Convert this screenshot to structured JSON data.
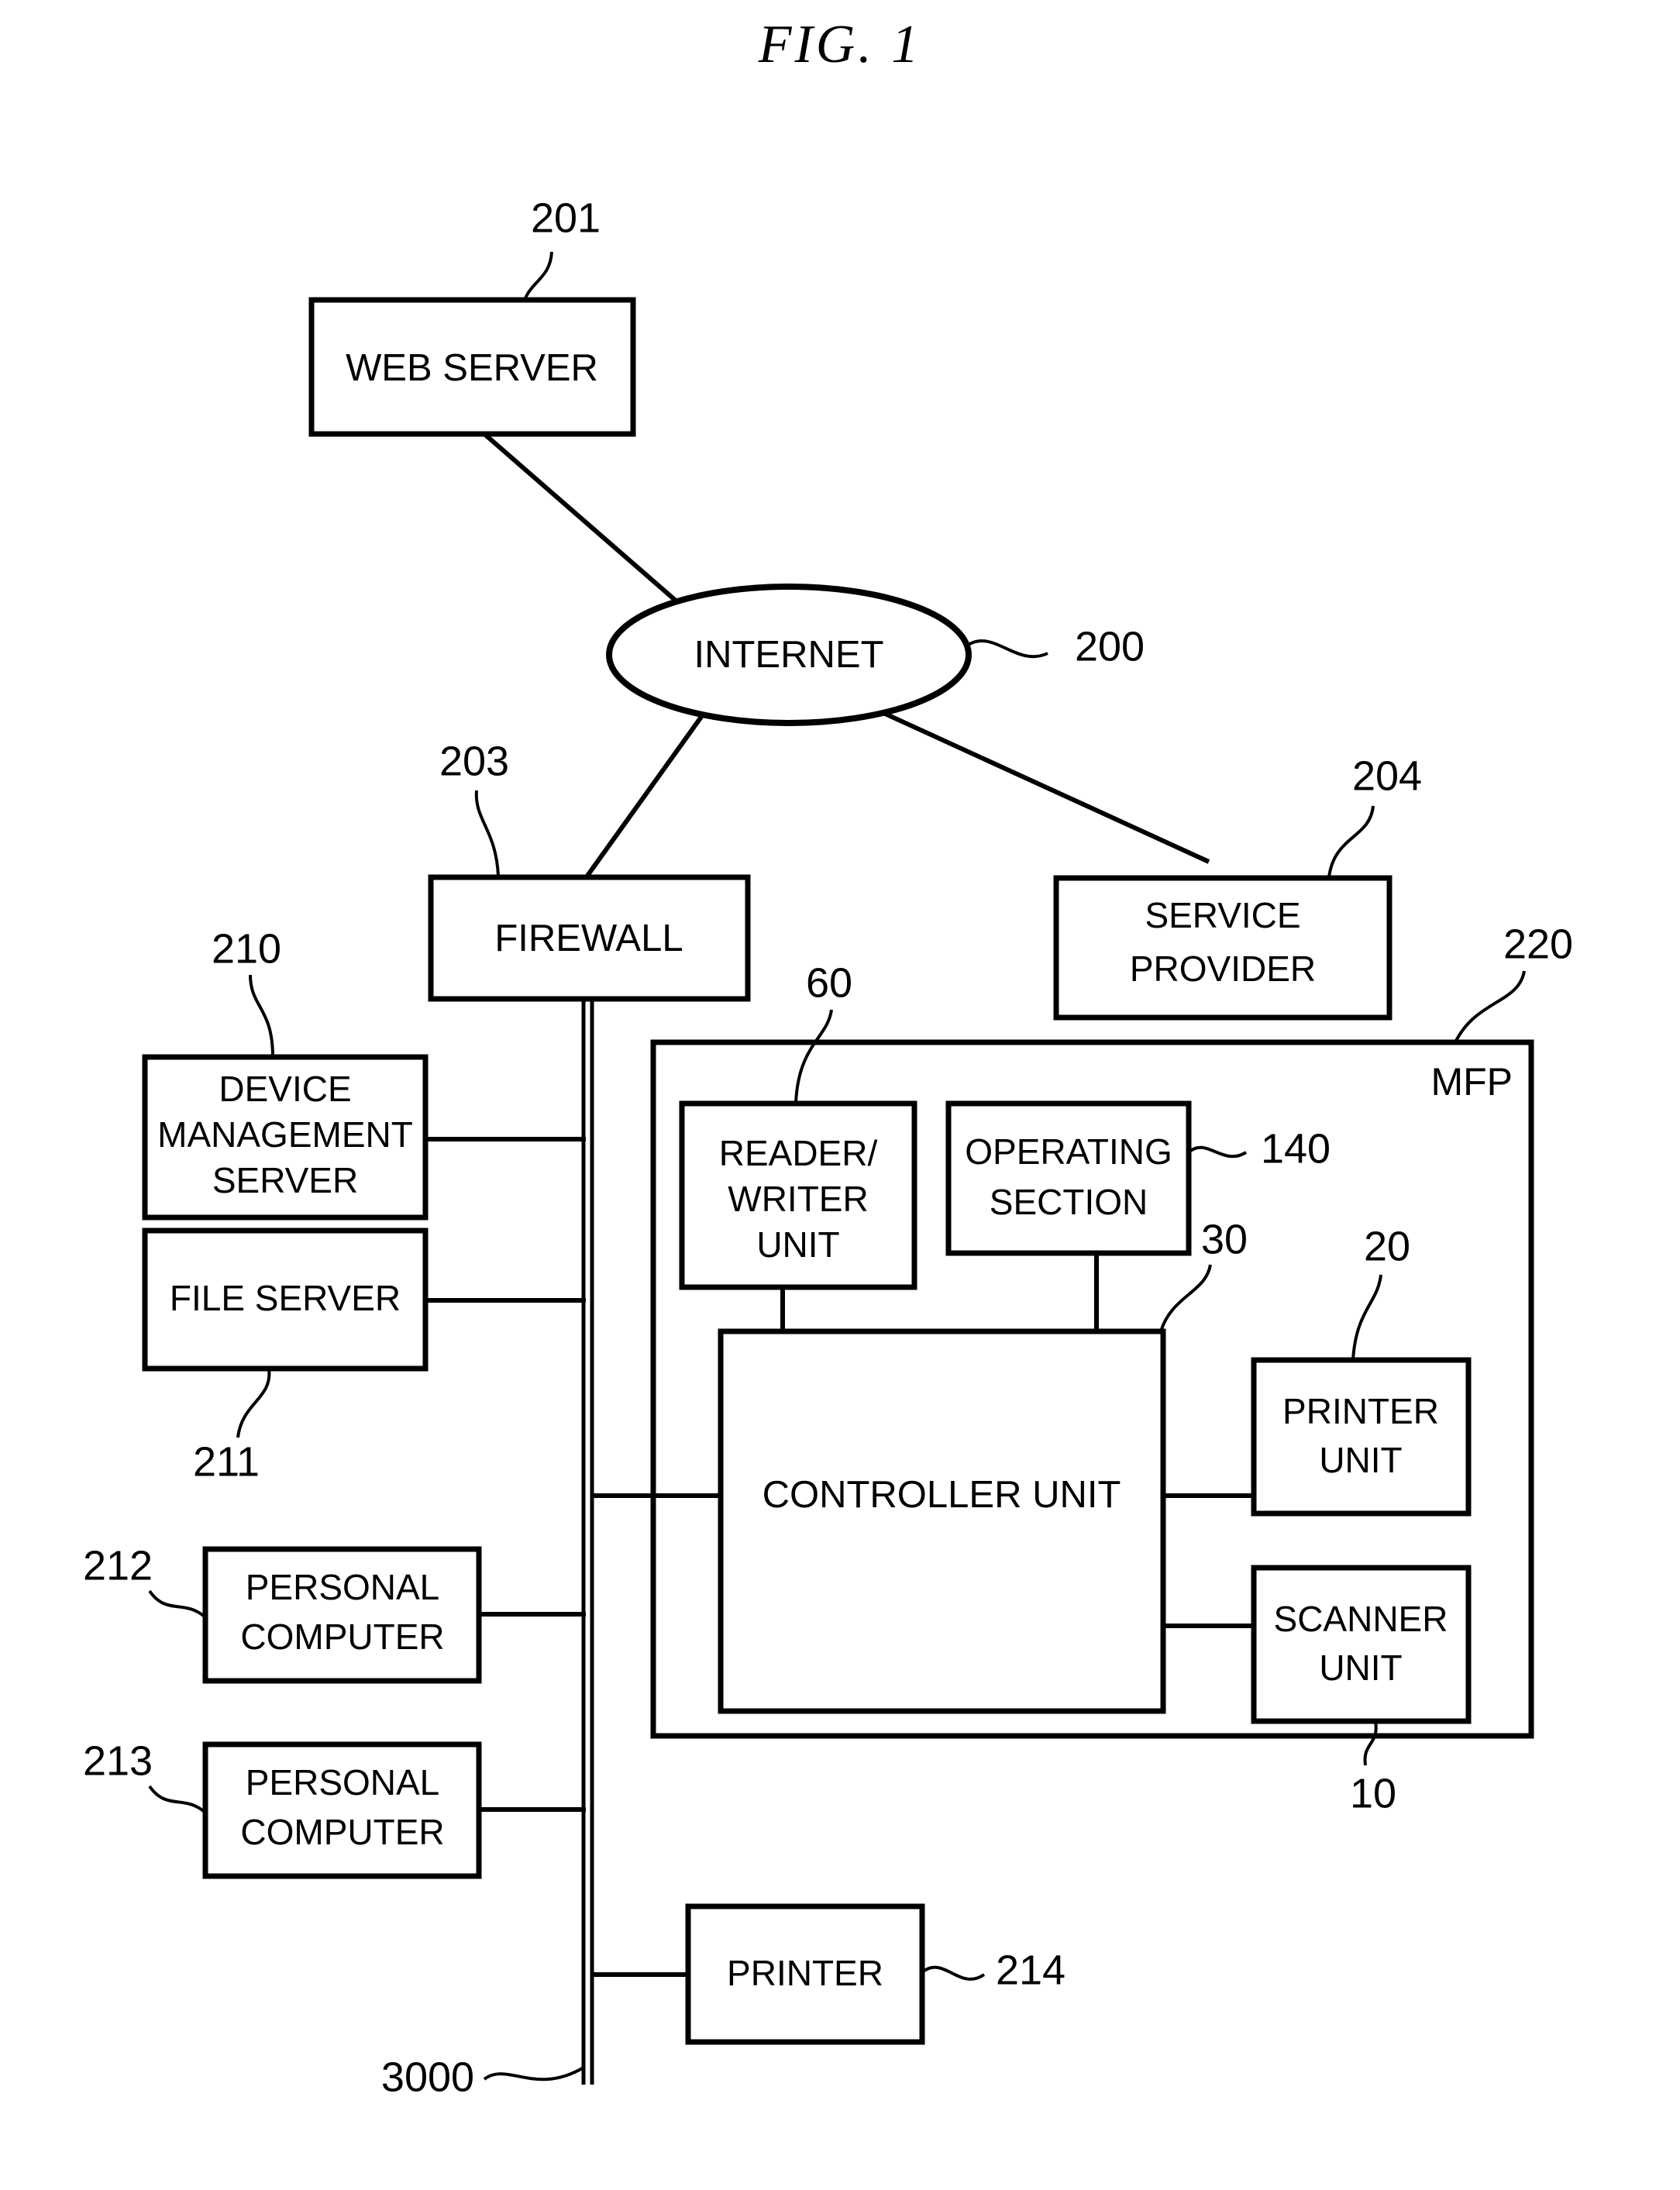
{
  "figure": {
    "title": "FIG. 1",
    "mfp_tag": "MFP"
  },
  "nodes": {
    "web_server": {
      "label": "WEB SERVER",
      "ref": "201"
    },
    "internet": {
      "label": "INTERNET",
      "ref": "200"
    },
    "firewall": {
      "label": "FIREWALL",
      "ref": "203"
    },
    "service_provider": {
      "label_line1": "SERVICE",
      "label_line2": "PROVIDER",
      "ref": "204"
    },
    "device_management_server": {
      "label_line1": "DEVICE",
      "label_line2": "MANAGEMENT",
      "label_line3": "SERVER",
      "ref": "210"
    },
    "file_server": {
      "label": "FILE SERVER",
      "ref": "211"
    },
    "personal_computer_1": {
      "label_line1": "PERSONAL",
      "label_line2": "COMPUTER",
      "ref": "212"
    },
    "personal_computer_2": {
      "label_line1": "PERSONAL",
      "label_line2": "COMPUTER",
      "ref": "213"
    },
    "printer": {
      "label": "PRINTER",
      "ref": "214"
    },
    "network_bus": {
      "ref": "3000"
    },
    "mfp": {
      "label": "MFP",
      "ref": "220"
    },
    "reader_writer_unit": {
      "label_line1": "READER/",
      "label_line2": "WRITER",
      "label_line3": "UNIT",
      "ref": "60"
    },
    "operating_section": {
      "label_line1": "OPERATING",
      "label_line2": "SECTION",
      "ref": "140"
    },
    "controller_unit": {
      "label": "CONTROLLER UNIT",
      "ref": "30"
    },
    "printer_unit": {
      "label_line1": "PRINTER",
      "label_line2": "UNIT",
      "ref": "20"
    },
    "scanner_unit": {
      "label_line1": "SCANNER",
      "label_line2": "UNIT",
      "ref": "10"
    }
  },
  "colors": {
    "ink": "#000000",
    "paper": "#ffffff"
  }
}
